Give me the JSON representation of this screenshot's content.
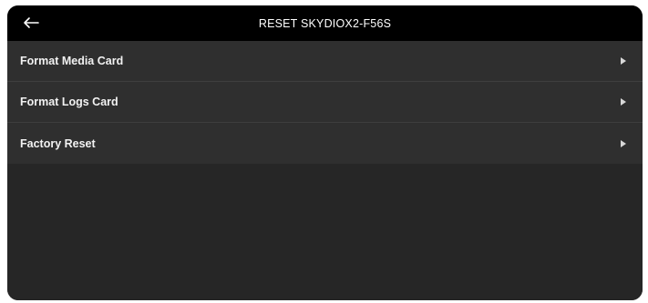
{
  "header": {
    "title": "RESET SKYDIOX2-F56S",
    "back_icon": "arrow-left-icon"
  },
  "menu": {
    "items": [
      {
        "label": "Format Media Card",
        "icon": "chevron-right-icon"
      },
      {
        "label": "Format Logs Card",
        "icon": "chevron-right-icon"
      },
      {
        "label": "Factory Reset",
        "icon": "chevron-right-icon"
      }
    ]
  },
  "colors": {
    "header_bg": "#000000",
    "row_bg": "#2f2f2f",
    "page_bg": "#262626",
    "text": "#f2f2f2"
  }
}
